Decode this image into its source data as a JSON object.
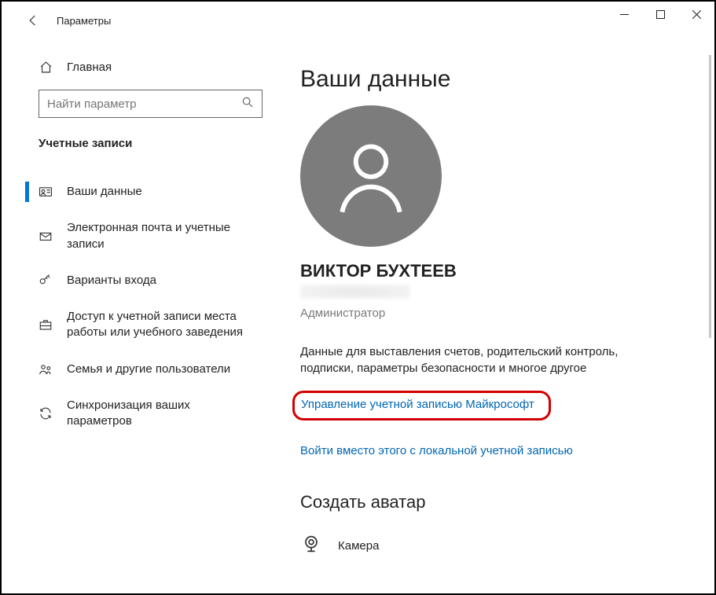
{
  "window": {
    "title": "Параметры"
  },
  "sidebar": {
    "home": "Главная",
    "search_placeholder": "Найти параметр",
    "section": "Учетные записи",
    "items": [
      {
        "label": "Ваши данные"
      },
      {
        "label": "Электронная почта и учетные записи"
      },
      {
        "label": "Варианты входа"
      },
      {
        "label": "Доступ к учетной записи места работы или учебного заведения"
      },
      {
        "label": "Семья и другие пользователи"
      },
      {
        "label": "Синхронизация ваших параметров"
      }
    ]
  },
  "main": {
    "heading": "Ваши данные",
    "user_name": "ВИКТОР БУХТЕЕВ",
    "role": "Администратор",
    "desc": "Данные для выставления счетов, родительский контроль, подписки, параметры безопасности и многое другое",
    "link_manage": "Управление учетной записью Майкрософт",
    "link_local": "Войти вместо этого с локальной учетной записью",
    "avatar_heading": "Создать аватар",
    "camera": "Камера"
  }
}
